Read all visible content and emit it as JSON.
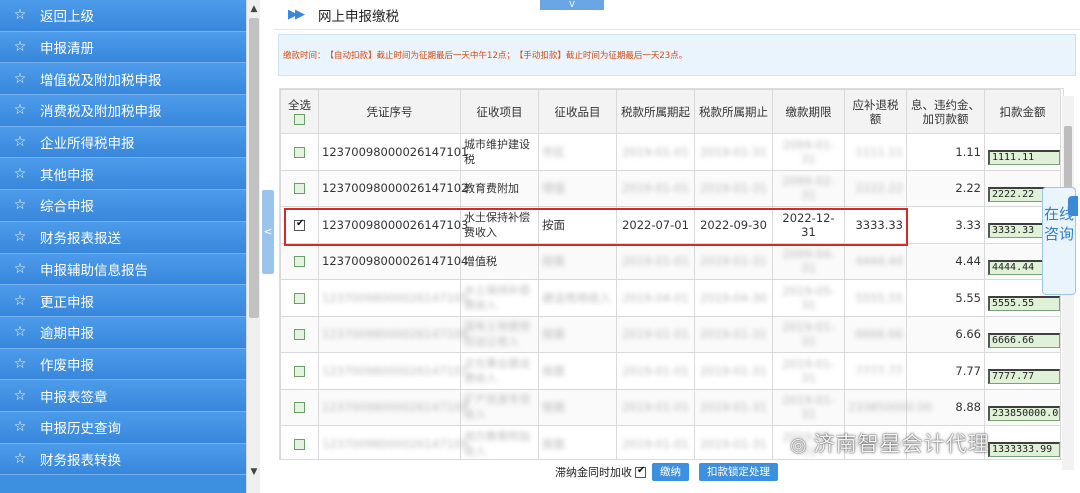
{
  "sidebar": {
    "items": [
      {
        "label": "返回上级"
      },
      {
        "label": "申报清册"
      },
      {
        "label": "增值税及附加税申报"
      },
      {
        "label": "消费税及附加税申报"
      },
      {
        "label": "企业所得税申报"
      },
      {
        "label": "其他申报"
      },
      {
        "label": "综合申报"
      },
      {
        "label": "财务报表报送"
      },
      {
        "label": "申报辅助信息报告"
      },
      {
        "label": "更正申报"
      },
      {
        "label": "逾期申报"
      },
      {
        "label": "作废申报"
      },
      {
        "label": "申报表签章"
      },
      {
        "label": "申报历史查询"
      },
      {
        "label": "财务报表转换"
      }
    ],
    "star_glyph": "☆"
  },
  "header": {
    "title": "网上申报缴税",
    "toggle_glyph": "V",
    "collapse_glyph": "<"
  },
  "notice": {
    "prefix": "缴款时间：",
    "auto_tag": "【自动扣款】",
    "auto_text": "截止时间为征期最后一天中午12点；",
    "manual_tag": "【手动扣款】",
    "manual_text": "截止时间为征期最后一天23点。"
  },
  "table": {
    "headers": {
      "select_all": "全选",
      "voucher": "凭证序号",
      "project": "征收项目",
      "item": "征收品目",
      "period_start": "税款所属期起",
      "period_end": "税款所属期止",
      "deadline": "缴款期限",
      "tax_due": "应补退税额",
      "penalty": "息、违约金、加罚款额",
      "deduct": "扣款金额"
    },
    "rows": [
      {
        "checked": false,
        "voucher": "12370098000026147101",
        "project": "城市维护建设税",
        "item": "市区",
        "start": "2019-01-01",
        "end": "2019-01-31",
        "deadline": "2099-01-31",
        "tax": "1111.11",
        "penalty": "1.11",
        "deduct": "1111.11",
        "blur": true
      },
      {
        "checked": false,
        "voucher": "12370098000026147102",
        "project": "教育费附加",
        "item": "增值",
        "start": "2019-01-01",
        "end": "2019-01-31",
        "deadline": "2099-02-31",
        "tax": "2222.22",
        "penalty": "2.22",
        "deduct": "2222.22",
        "blur": true
      },
      {
        "checked": true,
        "voucher": "12370098000026147103",
        "project": "水土保持补偿费收入",
        "item": "按面",
        "start": "2022-07-01",
        "end": "2022-09-30",
        "deadline": "2022-12-31",
        "tax": "3333.33",
        "penalty": "3.33",
        "deduct": "3333.33",
        "blur": false
      },
      {
        "checked": false,
        "voucher": "12370098000026147104",
        "project": "增值税",
        "item": "按面",
        "start": "2019-01-01",
        "end": "2019-01-31",
        "deadline": "2099-04-31",
        "tax": "4444.44",
        "penalty": "4.44",
        "deduct": "4444.44",
        "blur": true
      },
      {
        "checked": false,
        "voucher": "12370098000026147105",
        "project": "水土保持补偿费收入",
        "item": "建设用地收入",
        "start": "2019-04-01",
        "end": "2019-04-30",
        "deadline": "2019-05-31",
        "tax": "5555.55",
        "penalty": "5.55",
        "deduct": "5555.55",
        "blur": true
      },
      {
        "checked": false,
        "voucher": "12370098000026147106",
        "project": "国有土地使用权出让收入",
        "item": "按面",
        "start": "2019-01-01",
        "end": "2019-01-31",
        "deadline": "2019-01-31",
        "tax": "6666.66",
        "penalty": "6.66",
        "deduct": "6666.66",
        "blur": true
      },
      {
        "checked": false,
        "voucher": "12370098000026147107",
        "project": "文化事业建设费收入",
        "item": "按面",
        "start": "2019-01-01",
        "end": "2019-01-31",
        "deadline": "2019-01-31",
        "tax": "7777.77",
        "penalty": "7.77",
        "deduct": "7777.77",
        "blur": true
      },
      {
        "checked": false,
        "voucher": "12370098000026147108",
        "project": "矿产资源专项收入",
        "item": "按面",
        "start": "2019-01-01",
        "end": "2019-01-31",
        "deadline": "2019-01-31",
        "tax": "233850000.00",
        "penalty": "8.88",
        "deduct": "233850000.00",
        "blur": true
      },
      {
        "checked": false,
        "voucher": "12370098000026147109",
        "project": "地方教育附加收入",
        "item": "按面",
        "start": "2019-01-01",
        "end": "2019-01-31",
        "deadline": "2019-01-31",
        "tax": "9999.99",
        "penalty": "",
        "deduct": "1333333.99",
        "blur": true
      }
    ]
  },
  "consult": {
    "label": "在线咨询"
  },
  "footer": {
    "late_fee_label": "滞纳金同时加收",
    "late_fee_checked": true,
    "pay_button": "缴纳",
    "lock_button": "扣款锁定处理"
  },
  "watermark": {
    "text": "济南智星会计代理"
  },
  "colors": {
    "sidebar": "#3d8fe0",
    "highlight": "#d42a2a",
    "notice_text": "#d9480f",
    "amount_field": "#dff1d6"
  }
}
